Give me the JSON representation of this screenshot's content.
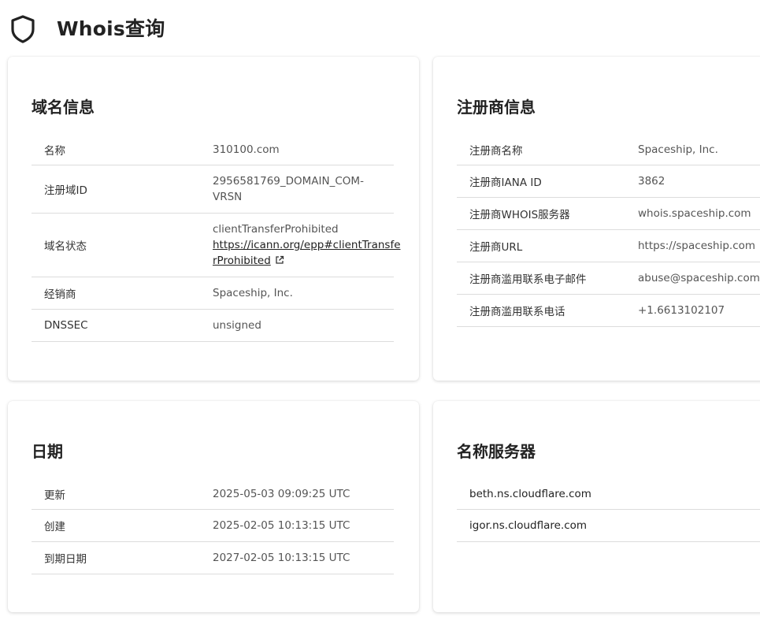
{
  "header": {
    "title": "Whois查询",
    "icon": "shield-icon"
  },
  "domain_info": {
    "title": "域名信息",
    "rows": [
      {
        "label": "名称",
        "value": "310100.com"
      },
      {
        "label": "注册域ID",
        "value_line1": "2956581769_DOMAIN_COM-",
        "value_line2": "VRSN"
      },
      {
        "label": "域名状态",
        "status": "clientTransferProhibited",
        "link_line1": "https://icann.org/epp#clientTransfe",
        "link_line2": "rProhibited",
        "link_icon": "external-link-icon"
      },
      {
        "label": "经销商",
        "value": "Spaceship, Inc."
      },
      {
        "label": "DNSSEC",
        "value": "unsigned"
      }
    ]
  },
  "registrar_info": {
    "title": "注册商信息",
    "rows": [
      {
        "label": "注册商名称",
        "value": "Spaceship, Inc."
      },
      {
        "label": "注册商IANA ID",
        "value": "3862"
      },
      {
        "label": "注册商WHOIS服务器",
        "value": "whois.spaceship.com"
      },
      {
        "label": "注册商URL",
        "value": "https://spaceship.com"
      },
      {
        "label": "注册商滥用联系电子邮件",
        "value": "abuse@spaceship.com"
      },
      {
        "label": "注册商滥用联系电话",
        "value": "+1.6613102107"
      }
    ]
  },
  "dates": {
    "title": "日期",
    "rows": [
      {
        "label": "更新",
        "value": "2025-05-03 09:09:25 UTC"
      },
      {
        "label": "创建",
        "value": "2025-02-05 10:13:15 UTC"
      },
      {
        "label": "到期日期",
        "value": "2027-02-05 10:13:15 UTC"
      }
    ]
  },
  "nameservers": {
    "title": "名称服务器",
    "items": [
      "beth.ns.cloudflare.com",
      "igor.ns.cloudflare.com"
    ]
  }
}
